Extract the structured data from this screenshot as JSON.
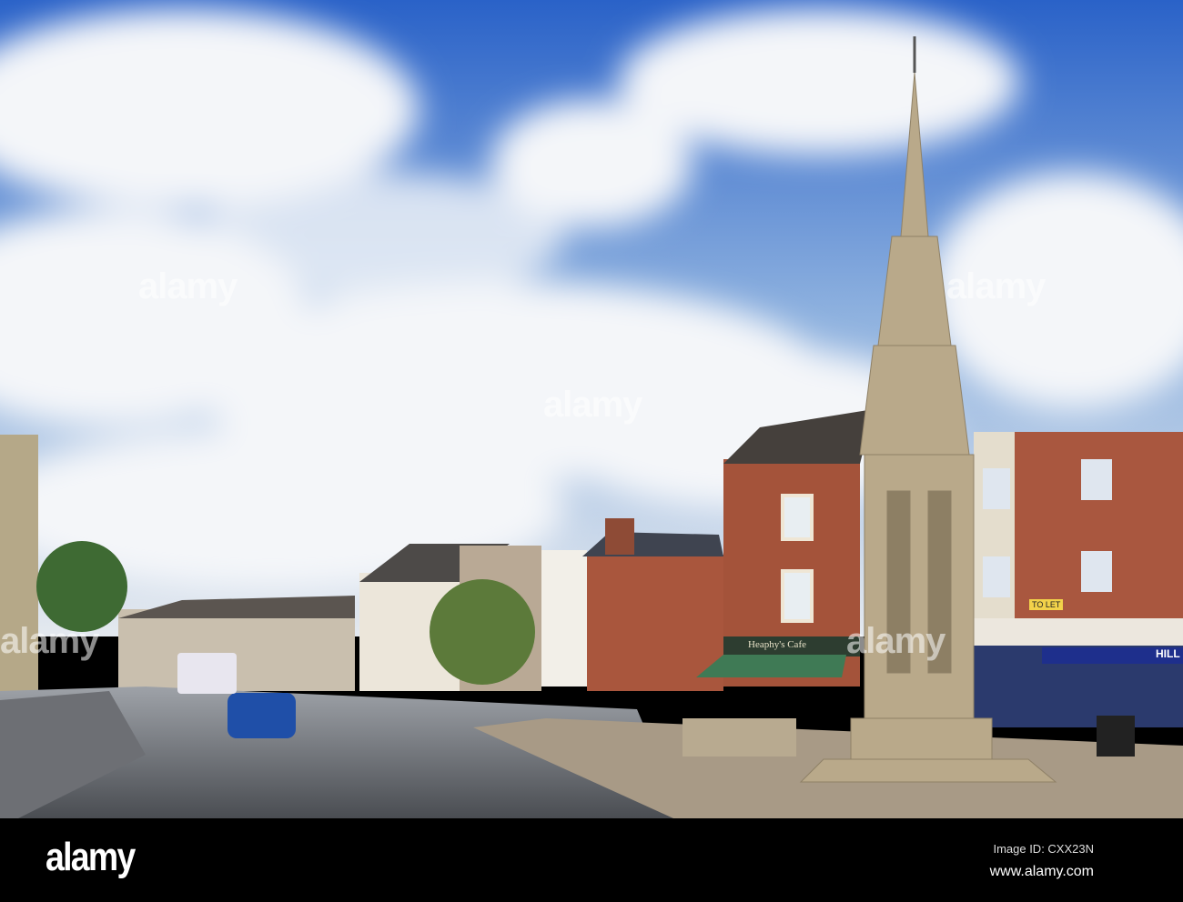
{
  "watermark": "alamy",
  "footer": {
    "logo": "alamy",
    "image_id": "Image ID: CXX23N",
    "url": "www.alamy.com"
  },
  "signs": {
    "cafe": "Heaphy's Cafe",
    "to_let": "TO LET",
    "shop": "HILL"
  },
  "colors": {
    "sky": "#2a6ad0",
    "brick": "#a4533a",
    "stone": "#b9a98a",
    "awning": "#3f7a55"
  }
}
